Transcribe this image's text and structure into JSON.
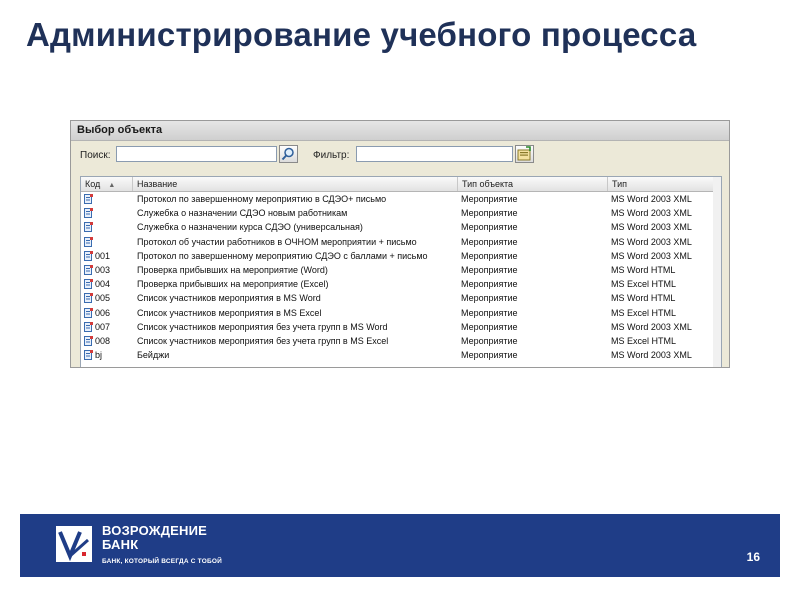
{
  "slide": {
    "title": "Администрирование учебного процесса",
    "page_number": "16"
  },
  "window": {
    "title": "Выбор объекта",
    "search_label": "Поиск:",
    "search_value": "",
    "filter_label": "Фильтр:",
    "filter_value": "",
    "search_button_icon": "search-icon",
    "filter_button_icon": "filter-icon"
  },
  "grid": {
    "columns": [
      "Код",
      "Название",
      "Тип объекта",
      "Тип"
    ],
    "rows": [
      {
        "code": "",
        "name": "Протокол по завершенному мероприятию в СДЭО+ письмо",
        "type": "Мероприятие",
        "format": "MS Word 2003 XML"
      },
      {
        "code": "",
        "name": "Служебка о назначении СДЭО новым работникам",
        "type": "Мероприятие",
        "format": "MS Word 2003 XML"
      },
      {
        "code": "",
        "name": "Служебка о назначении курса СДЭО (универсальная)",
        "type": "Мероприятие",
        "format": "MS Word 2003 XML"
      },
      {
        "code": "",
        "name": "Протокол об участии работников в ОЧНОМ мероприятии + письмо",
        "type": "Мероприятие",
        "format": "MS Word 2003 XML"
      },
      {
        "code": "001",
        "name": "Протокол по завершенному мероприятию СДЭО с баллами + письмо",
        "type": "Мероприятие",
        "format": "MS Word 2003 XML"
      },
      {
        "code": "003",
        "name": "Проверка прибывших на мероприятие (Word)",
        "type": "Мероприятие",
        "format": "MS Word HTML"
      },
      {
        "code": "004",
        "name": "Проверка прибывших на мероприятие (Excel)",
        "type": "Мероприятие",
        "format": "MS Excel HTML"
      },
      {
        "code": "005",
        "name": "Список участников мероприятия в MS Word",
        "type": "Мероприятие",
        "format": "MS Word HTML"
      },
      {
        "code": "006",
        "name": "Список участников мероприятия в MS Excel",
        "type": "Мероприятие",
        "format": "MS Excel HTML"
      },
      {
        "code": "007",
        "name": "Список участников мероприятия без учета групп в MS Word",
        "type": "Мероприятие",
        "format": "MS Word 2003 XML"
      },
      {
        "code": "008",
        "name": "Список участников мероприятия без учета групп в MS Excel",
        "type": "Мероприятие",
        "format": "MS Excel HTML"
      },
      {
        "code": "bj",
        "name": "Бейджи",
        "type": "Мероприятие",
        "format": "MS Word 2003 XML"
      }
    ]
  },
  "footer": {
    "brand_line1": "ВОЗРОЖДЕНИЕ",
    "brand_line2": "БАНК",
    "tagline": "БАНК, КОТОРЫЙ ВСЕГДА С ТОБОЙ",
    "logo_icon": "bank-logo-icon",
    "background_color": "#1f3d87"
  }
}
